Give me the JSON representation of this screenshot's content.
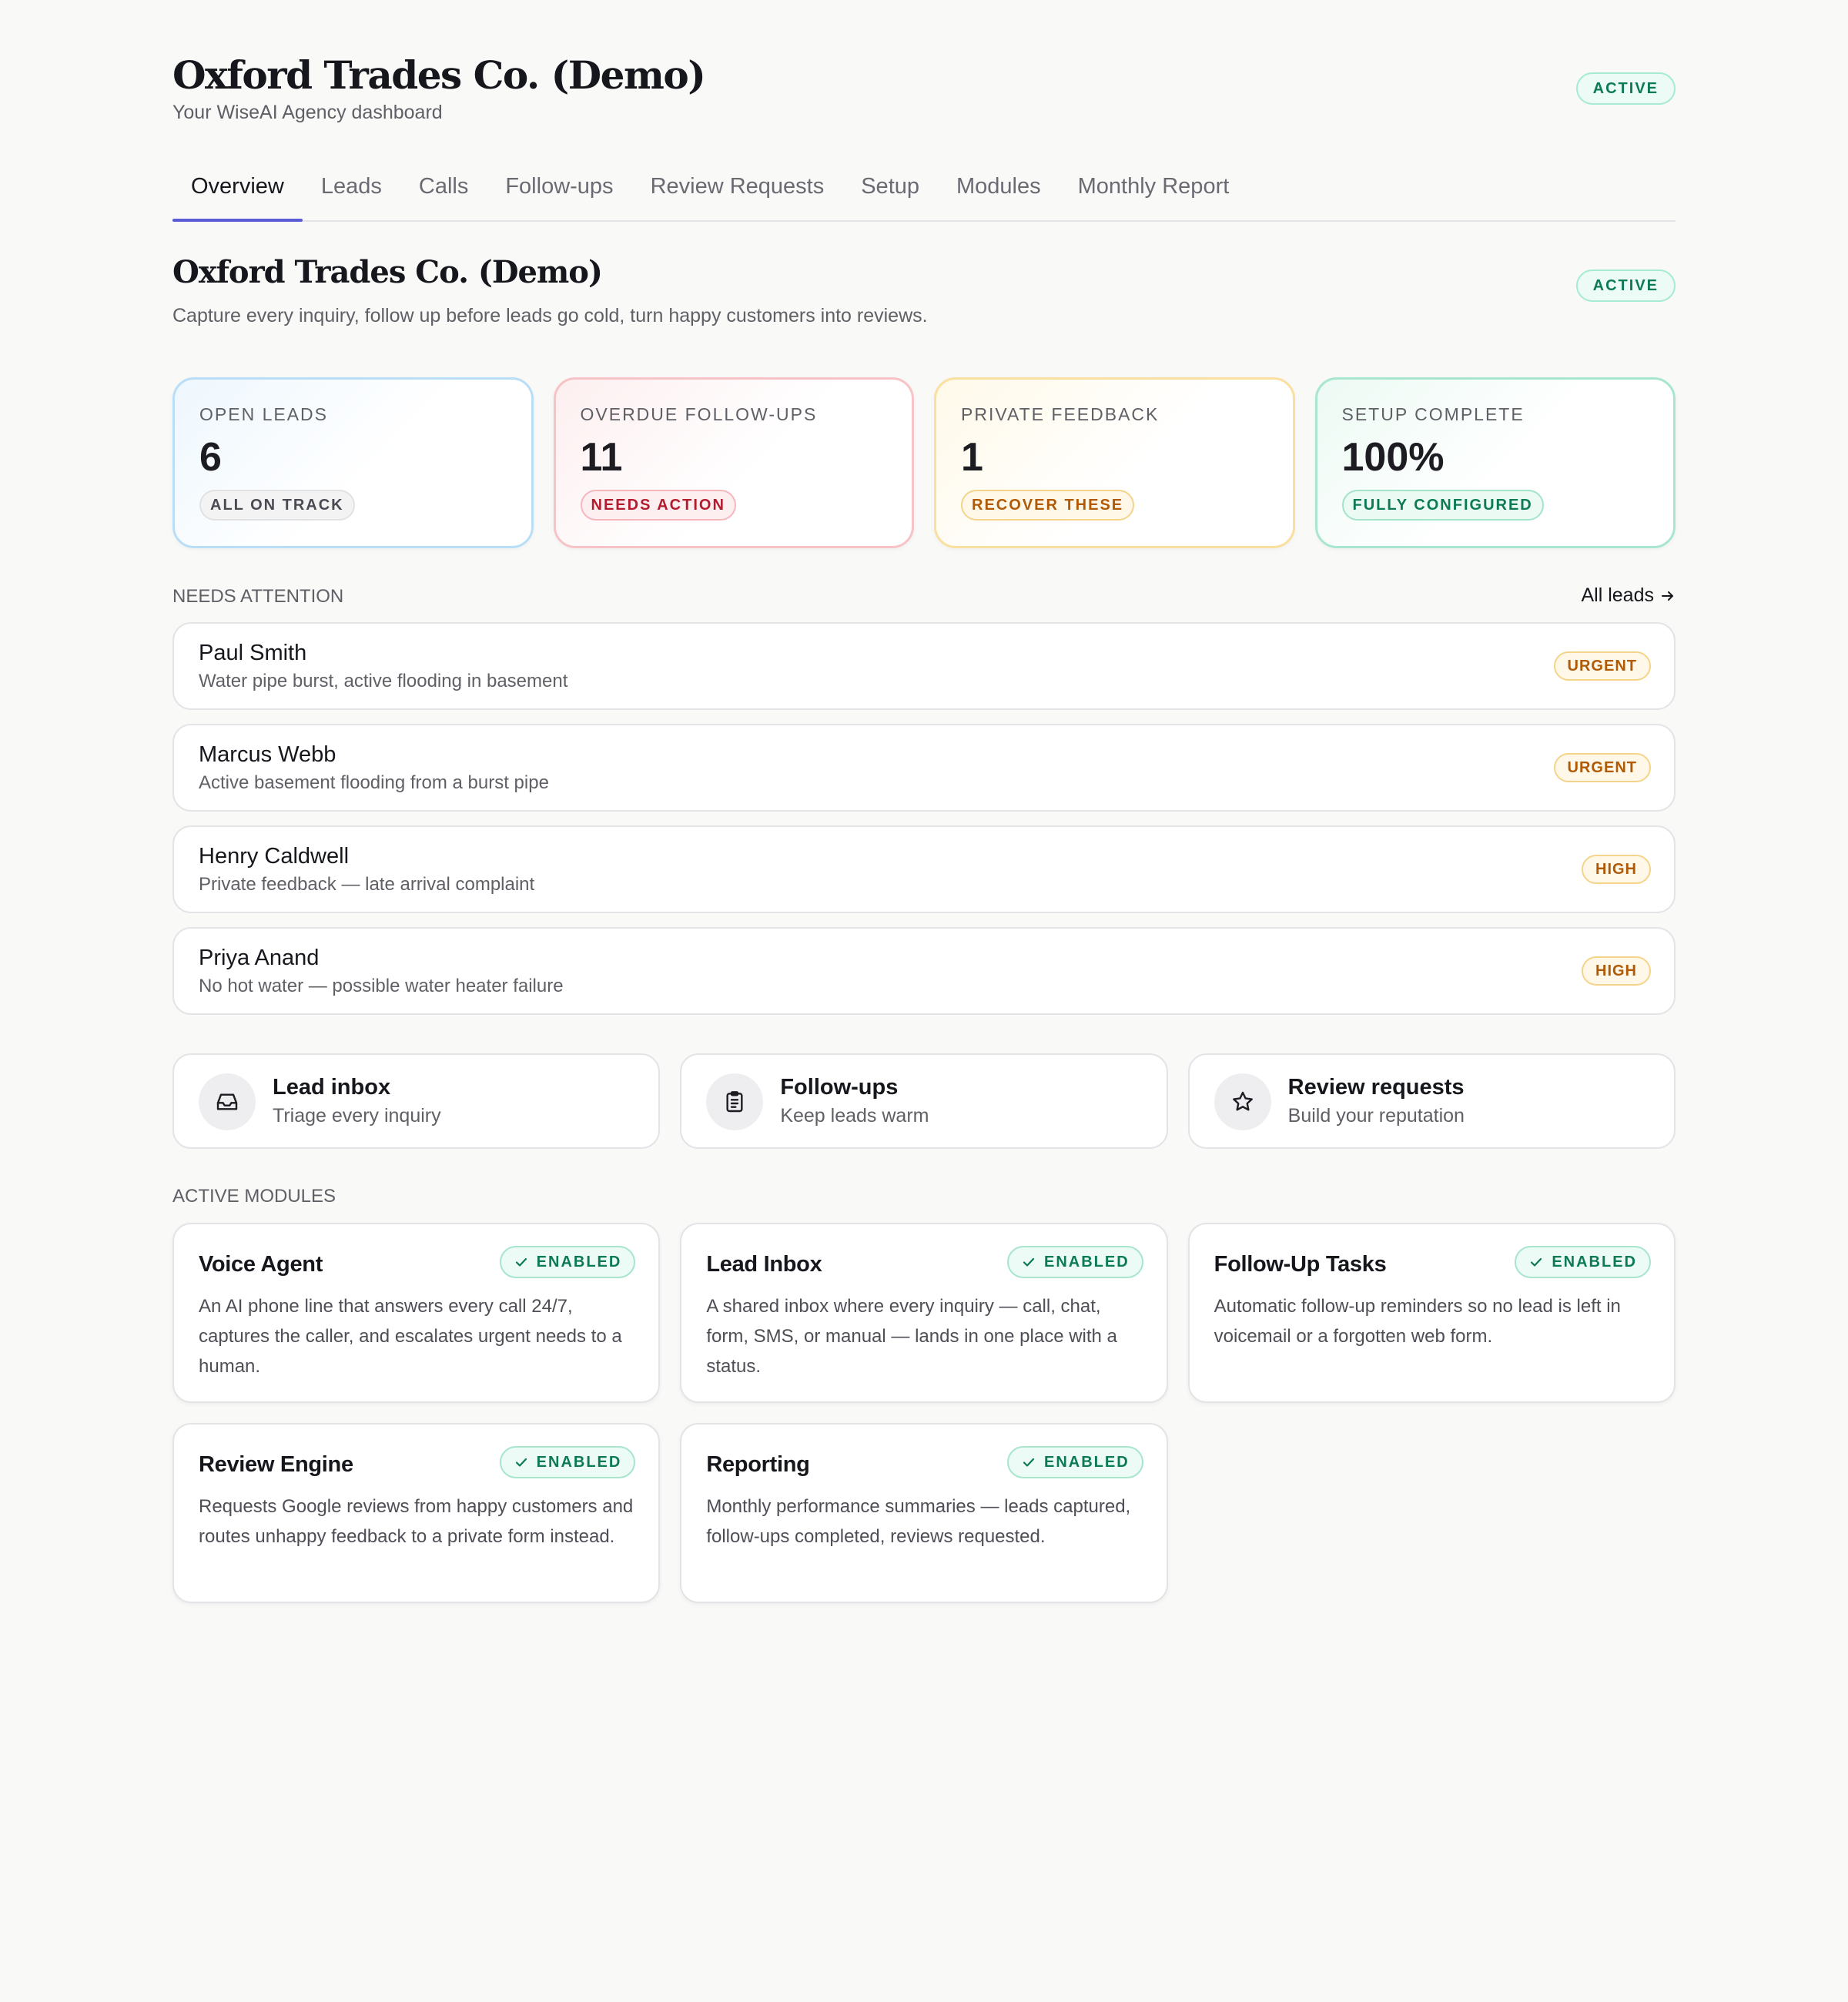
{
  "header": {
    "title": "Oxford Trades Co. (Demo)",
    "subtitle": "Your WiseAI Agency dashboard",
    "status": "ACTIVE"
  },
  "tabs": [
    {
      "label": "Overview",
      "active": true
    },
    {
      "label": "Leads"
    },
    {
      "label": "Calls"
    },
    {
      "label": "Follow-ups"
    },
    {
      "label": "Review Requests"
    },
    {
      "label": "Setup"
    },
    {
      "label": "Modules"
    },
    {
      "label": "Monthly Report"
    }
  ],
  "section": {
    "title": "Oxford Trades Co. (Demo)",
    "description": "Capture every inquiry, follow up before leads go cold, turn happy customers into reviews.",
    "status": "ACTIVE"
  },
  "stats": [
    {
      "label": "OPEN LEADS",
      "value": "6",
      "badge": "ALL ON TRACK"
    },
    {
      "label": "OVERDUE FOLLOW-UPS",
      "value": "11",
      "badge": "NEEDS ACTION"
    },
    {
      "label": "PRIVATE FEEDBACK",
      "value": "1",
      "badge": "RECOVER THESE"
    },
    {
      "label": "SETUP COMPLETE",
      "value": "100%",
      "badge": "FULLY CONFIGURED"
    }
  ],
  "needs_attention": {
    "label": "NEEDS ATTENTION",
    "link": "All leads",
    "leads": [
      {
        "name": "Paul Smith",
        "detail": "Water pipe burst, active flooding in basement",
        "priority": "URGENT"
      },
      {
        "name": "Marcus Webb",
        "detail": "Active basement flooding from a burst pipe",
        "priority": "URGENT"
      },
      {
        "name": "Henry Caldwell",
        "detail": "Private feedback — late arrival complaint",
        "priority": "HIGH"
      },
      {
        "name": "Priya Anand",
        "detail": "No hot water — possible water heater failure",
        "priority": "HIGH"
      }
    ]
  },
  "shortcuts": [
    {
      "title": "Lead inbox",
      "subtitle": "Triage every inquiry",
      "icon": "inbox-icon"
    },
    {
      "title": "Follow-ups",
      "subtitle": "Keep leads warm",
      "icon": "clipboard-icon"
    },
    {
      "title": "Review requests",
      "subtitle": "Build your reputation",
      "icon": "star-icon"
    }
  ],
  "modules": {
    "label": "ACTIVE MODULES",
    "items": [
      {
        "title": "Voice Agent",
        "status": "ENABLED",
        "description": "An AI phone line that answers every call 24/7, captures the caller, and escalates urgent needs to a human."
      },
      {
        "title": "Lead Inbox",
        "status": "ENABLED",
        "description": "A shared inbox where every inquiry — call, chat, form, SMS, or manual — lands in one place with a status."
      },
      {
        "title": "Follow-Up Tasks",
        "status": "ENABLED",
        "description": "Automatic follow-up reminders so no lead is left in voicemail or a forgotten web form."
      },
      {
        "title": "Review Engine",
        "status": "ENABLED",
        "description": "Requests Google reviews from happy customers and routes unhappy feedback to a private form instead."
      },
      {
        "title": "Reporting",
        "status": "ENABLED",
        "description": "Monthly performance summaries — leads captured, follow-ups completed, reviews requested."
      }
    ]
  },
  "colors": {
    "accent": "#5b5bd6",
    "success": "#0b7a55",
    "danger": "#b21c2e",
    "warning": "#b05a06"
  }
}
